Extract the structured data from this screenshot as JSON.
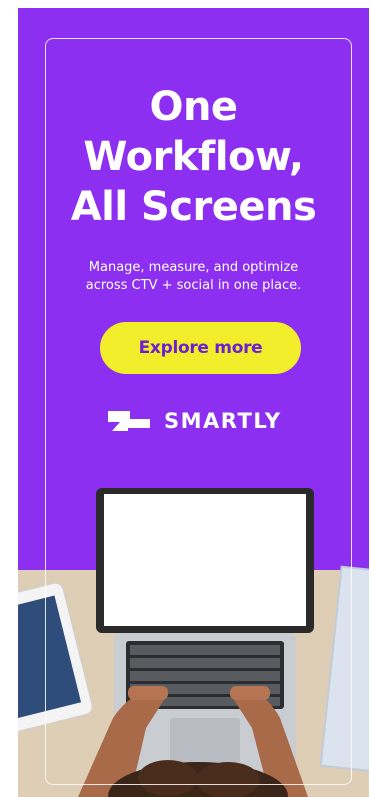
{
  "ad": {
    "headline": [
      "One",
      "Workflow,",
      "All Screens"
    ],
    "subtext": [
      "Manage, measure, and optimize",
      "across CTV + social in one place."
    ],
    "cta_label": "Explore more",
    "brand_name": "SMARTLY"
  },
  "colors": {
    "background": "#8c2ff0",
    "cta_background": "#f2ee2b",
    "cta_text": "#6f1fd0",
    "text": "#ffffff"
  },
  "icons": [
    "smartly-logo-icon"
  ],
  "image": "top-down photo of hands typing on a laptop on a wooden desk with a tablet and notebook"
}
